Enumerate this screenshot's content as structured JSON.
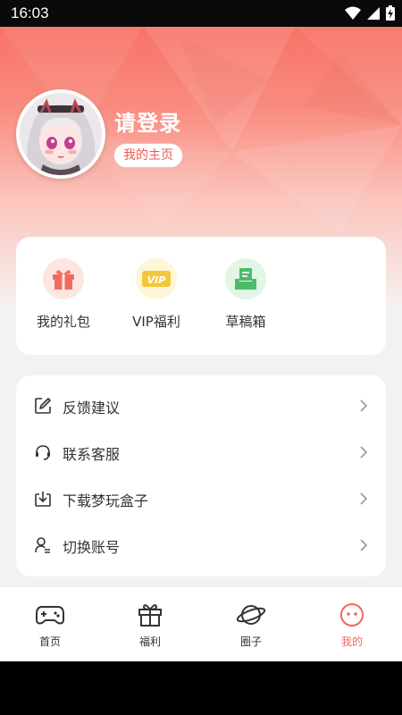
{
  "status": {
    "time": "16:03"
  },
  "profile": {
    "username": "请登录",
    "homepage_button": "我的主页"
  },
  "welfare": {
    "items": [
      {
        "label": "我的礼包",
        "icon": "gift-icon"
      },
      {
        "label": "VIP福利",
        "icon": "vip-icon"
      },
      {
        "label": "草稿箱",
        "icon": "draft-box-icon"
      }
    ]
  },
  "menu": {
    "items": [
      {
        "label": "反馈建议",
        "icon": "edit-icon"
      },
      {
        "label": "联系客服",
        "icon": "headset-icon"
      },
      {
        "label": "下载梦玩盒子",
        "icon": "download-icon"
      },
      {
        "label": "切换账号",
        "icon": "switch-user-icon"
      }
    ]
  },
  "tabs": [
    {
      "label": "首页",
      "icon": "gamepad-icon"
    },
    {
      "label": "福利",
      "icon": "gift-icon"
    },
    {
      "label": "圈子",
      "icon": "planet-icon"
    },
    {
      "label": "我的",
      "icon": "smiley-icon",
      "active": true
    }
  ],
  "colors": {
    "accent": "#f0675d",
    "header_top": "#f76a5f"
  }
}
